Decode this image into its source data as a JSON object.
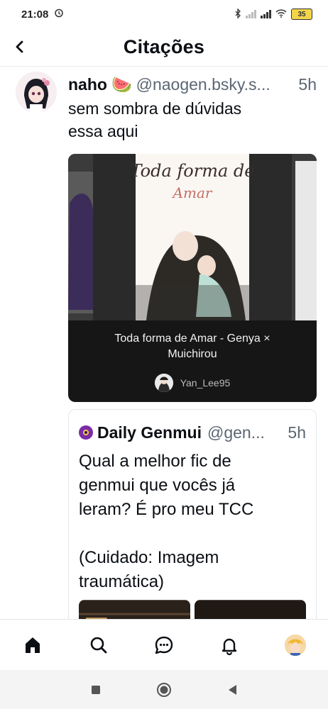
{
  "status_bar": {
    "time": "21:08",
    "battery": "35"
  },
  "header": {
    "title": "Citações"
  },
  "post": {
    "author_name": "naho",
    "author_emoji": "🍉",
    "handle": "@naogen.bsky.s...",
    "time": "5h",
    "text_line1": "sem sombra de dúvidas",
    "text_line2": "essa aqui"
  },
  "embed": {
    "cover_title_line1": "Toda forma de",
    "cover_title_line2": "Amar",
    "title": "Toda forma de Amar - Genya × Muichirou",
    "author": "Yan_Lee95"
  },
  "quote": {
    "author_name": "Daily Genmui",
    "handle": "@gen...",
    "time": "5h",
    "text": "Qual a melhor fic de\ngenmui que vocês já\nleram? É pro meu TCC\n\n(Cuidado: Imagem\ntraumática)"
  },
  "colors": {
    "text": "#0b0f14",
    "muted": "#5b6673",
    "embed_bg": "#161616",
    "divider": "#e3e7ea"
  },
  "bottom_nav": {
    "items": [
      "home-icon",
      "search-icon",
      "chat-icon",
      "bell-icon",
      "profile-avatar"
    ]
  },
  "system_nav": {
    "items": [
      "recents-icon",
      "home-circle-icon",
      "back-triangle-icon"
    ]
  }
}
